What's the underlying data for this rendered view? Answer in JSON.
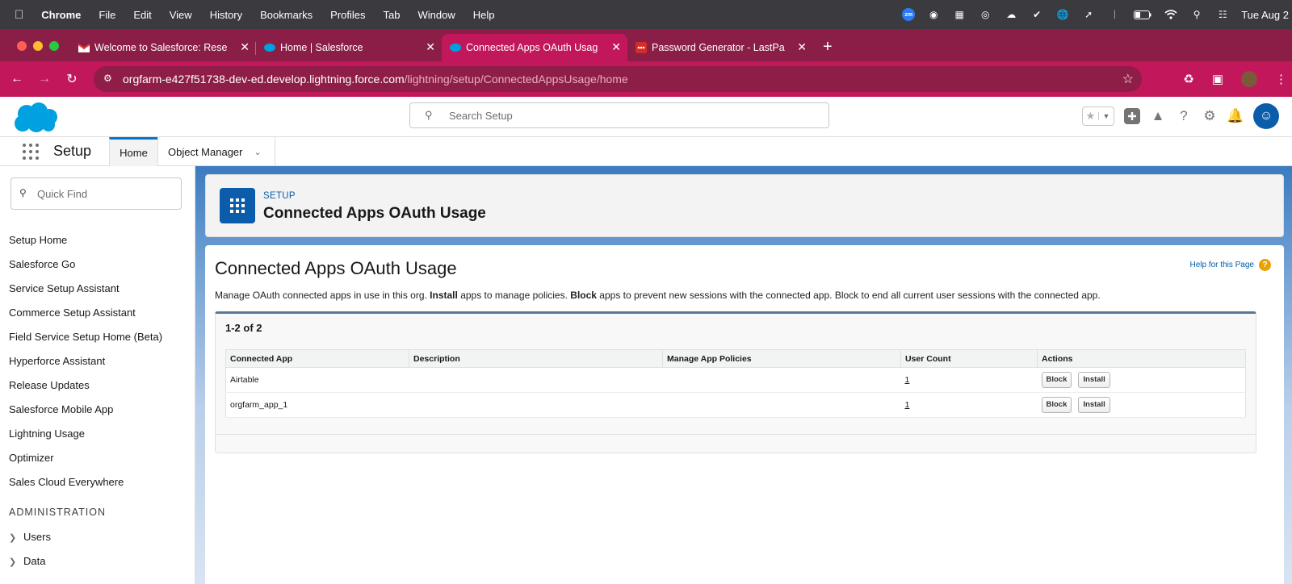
{
  "mac_menu": {
    "app": "Chrome",
    "items": [
      "File",
      "Edit",
      "View",
      "History",
      "Bookmarks",
      "Profiles",
      "Tab",
      "Window",
      "Help"
    ],
    "zoom_label": "zm",
    "clock": "Tue Aug 2"
  },
  "tabs": [
    {
      "title": "Welcome to Salesforce: Rese",
      "icon": "gmail-icon"
    },
    {
      "title": "Home | Salesforce",
      "icon": "salesforce-cloud-icon"
    },
    {
      "title": "Connected Apps OAuth Usag",
      "icon": "salesforce-cloud-icon",
      "active": true
    },
    {
      "title": "Password Generator - LastPa",
      "icon": "lastpass-icon"
    }
  ],
  "address": {
    "host": "orgfarm-e427f51738-dev-ed.develop.lightning.force.com",
    "path": "/lightning/setup/ConnectedAppsUsage/home"
  },
  "header": {
    "search_placeholder": "Search Setup"
  },
  "nav": {
    "app_name": "Setup",
    "tabs": [
      "Home",
      "Object Manager"
    ]
  },
  "sidebar": {
    "quick_find_placeholder": "Quick Find",
    "items": [
      "Setup Home",
      "Salesforce Go",
      "Service Setup Assistant",
      "Commerce Setup Assistant",
      "Field Service Setup Home (Beta)",
      "Hyperforce Assistant",
      "Release Updates",
      "Salesforce Mobile App",
      "Lightning Usage",
      "Optimizer",
      "Sales Cloud Everywhere"
    ],
    "section_title": "ADMINISTRATION",
    "groups": [
      "Users",
      "Data"
    ]
  },
  "page_header": {
    "breadcrumb": "SETUP",
    "title": "Connected Apps OAuth Usage"
  },
  "content": {
    "heading": "Connected Apps OAuth Usage",
    "help_link": "Help for this Page",
    "desc_1": "Manage OAuth connected apps in use in this org. ",
    "desc_install": "Install",
    "desc_2": " apps to manage policies. ",
    "desc_block": "Block",
    "desc_3": " apps to prevent new sessions with the connected app. Block to end all current user sessions with the connected app.",
    "count_label": "1-2 of 2",
    "columns": [
      "Connected App",
      "Description",
      "Manage App Policies",
      "User Count",
      "Actions"
    ],
    "rows": [
      {
        "app": "Airtable",
        "description": "",
        "policies": "",
        "user_count": "1"
      },
      {
        "app": "orgfarm_app_1",
        "description": "",
        "policies": "",
        "user_count": "1"
      }
    ],
    "block_label": "Block",
    "install_label": "Install"
  }
}
